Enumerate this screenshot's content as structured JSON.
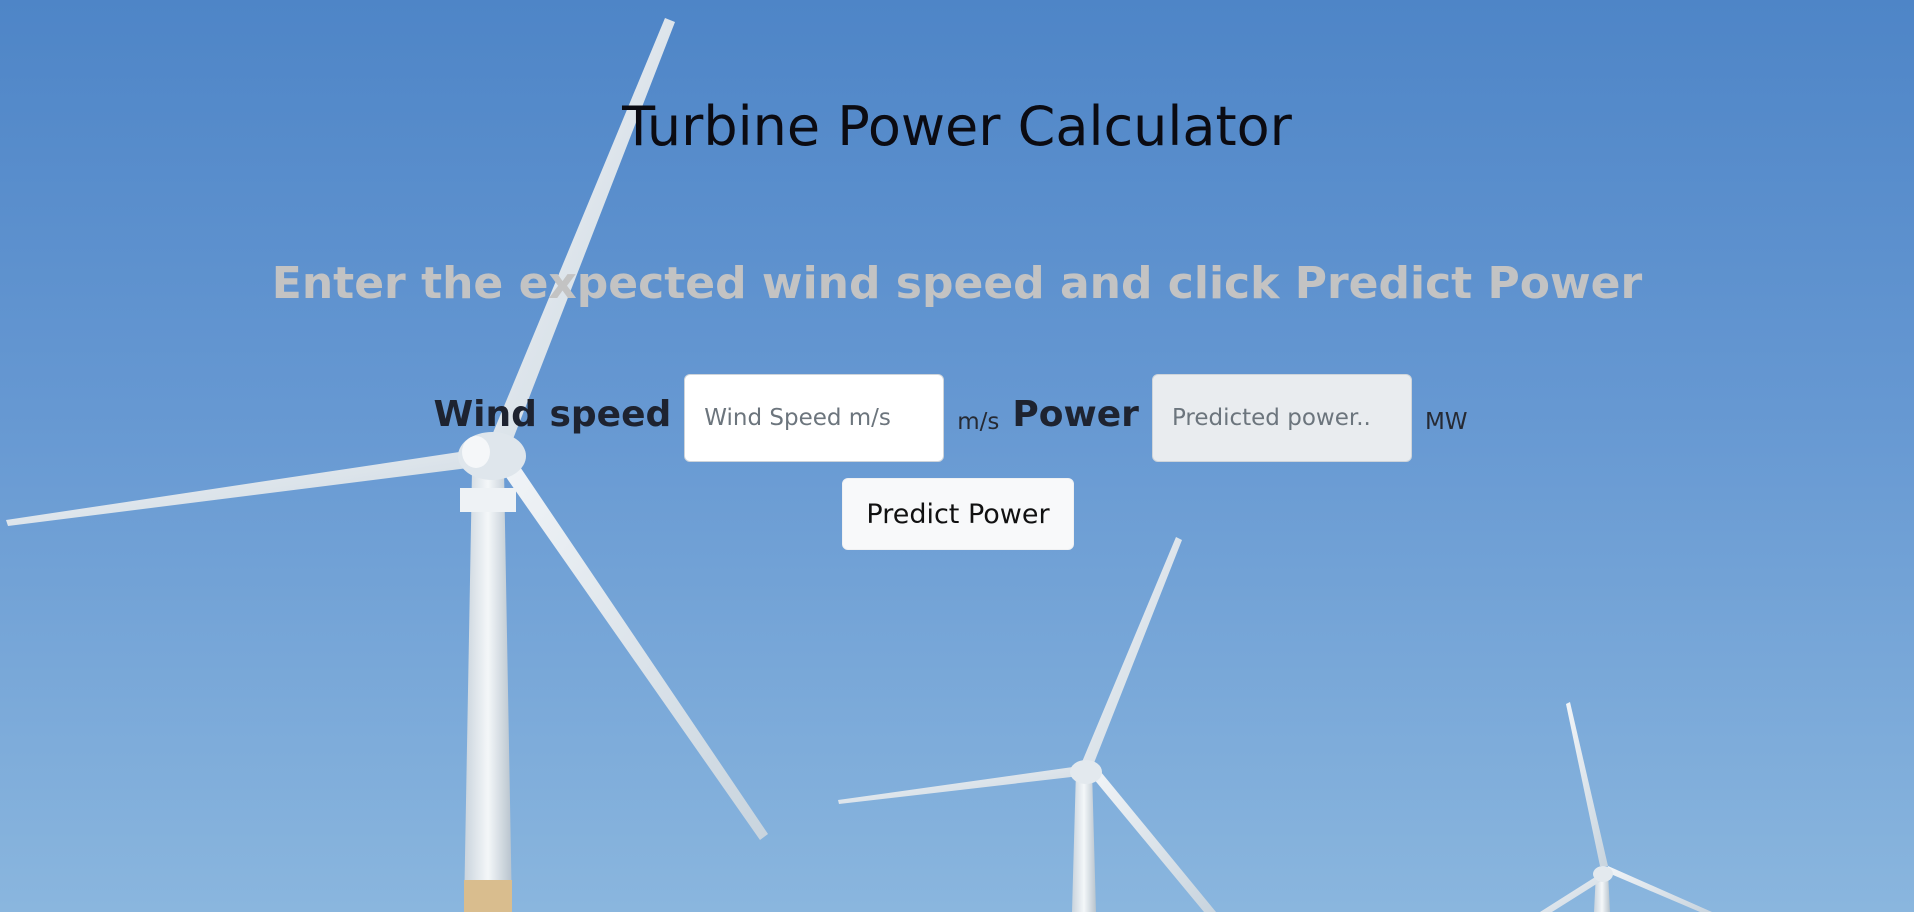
{
  "page": {
    "title": "Turbine Power Calculator",
    "subtitle": "Enter the expected wind speed and click Predict Power"
  },
  "form": {
    "wind_label": "Wind speed",
    "wind_placeholder": "Wind Speed m/s",
    "wind_value": "",
    "wind_unit": "m/s",
    "power_label": "Power",
    "power_placeholder": "Predicted power..",
    "power_value": "",
    "power_unit": "MW",
    "predict_label": "Predict Power"
  },
  "background": {
    "subject": "wind-turbines-photo",
    "sky_color": "#5e92d0",
    "blade_color": "#e4eaf0"
  }
}
